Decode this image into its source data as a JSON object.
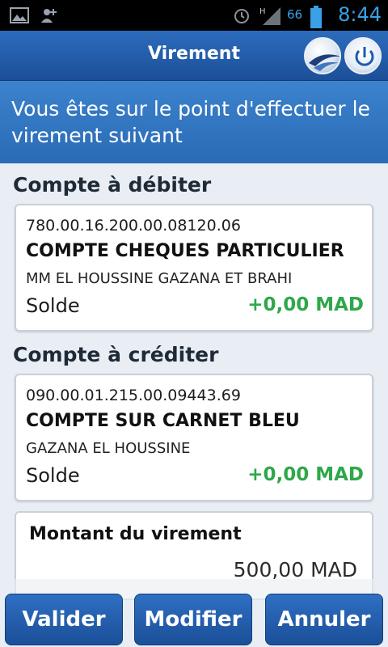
{
  "status_bar": {
    "left_icons": [
      "image-icon",
      "contact-add-icon"
    ],
    "right_icons": [
      "alarm-icon",
      "signal-h-icon",
      "battery-icon"
    ],
    "battery_level": "66",
    "time": "8:44"
  },
  "header": {
    "title": "Virement",
    "logo_icon": "bank-logo-icon",
    "power_icon": "power-icon"
  },
  "intro": {
    "text": "Vous êtes sur le point d'effectuer le virement suivant"
  },
  "debit": {
    "section_label": "Compte à débiter",
    "account_number": "780.00.16.200.00.08120.06",
    "account_type": "COMPTE CHEQUES PARTICULIER",
    "holder": "MM EL HOUSSINE GAZANA ET BRAHI",
    "balance_label": "Solde",
    "balance_value": "+0,00 MAD"
  },
  "credit": {
    "section_label": "Compte à créditer",
    "account_number": "090.00.01.215.00.09443.69",
    "account_type": "COMPTE SUR CARNET BLEU",
    "holder": "GAZANA EL HOUSSINE",
    "balance_label": "Solde",
    "balance_value": "+0,00 MAD"
  },
  "amount": {
    "label": "Montant du virement",
    "value": "500,00 MAD"
  },
  "actions": {
    "validate_label": "Valider",
    "modify_label": "Modifier",
    "cancel_label": "Annuler"
  },
  "colors": {
    "brand_blue": "#1c4f98",
    "positive_green": "#2ea84a"
  }
}
